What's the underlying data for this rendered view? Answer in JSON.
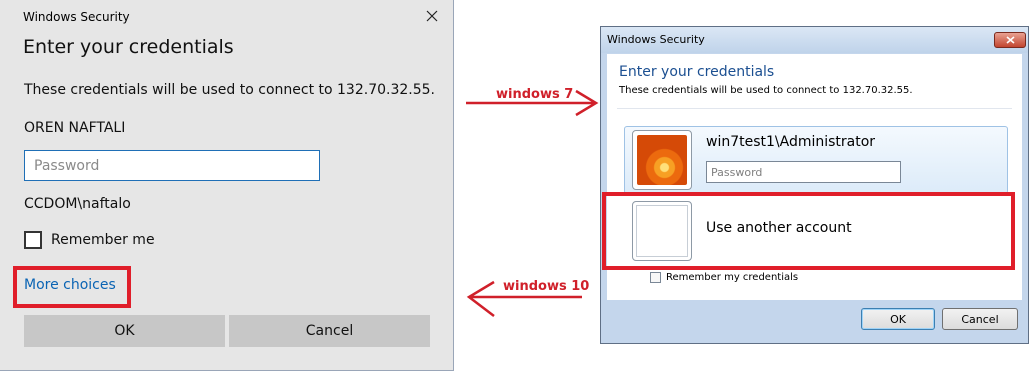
{
  "win10": {
    "title": "Windows Security",
    "heading": "Enter your credentials",
    "description": "These credentials will be used to connect to 132.70.32.55.",
    "username": "OREN NAFTALI",
    "password_placeholder": "Password",
    "domain_user": "CCDOM\\naftalo",
    "remember_label": "Remember me",
    "more_choices": "More choices",
    "ok_label": "OK",
    "cancel_label": "Cancel"
  },
  "annotations": {
    "win7_label": "windows 7",
    "win10_label": "windows 10",
    "highlight_color": "#e01e2a"
  },
  "win7": {
    "title": "Windows Security",
    "heading": "Enter your credentials",
    "description": "These credentials will be used to connect to 132.70.32.55.",
    "username": "win7test1\\Administrator",
    "password_placeholder": "Password",
    "another_account": "Use another account",
    "remember_label": "Remember my credentials",
    "ok_label": "OK",
    "cancel_label": "Cancel"
  }
}
